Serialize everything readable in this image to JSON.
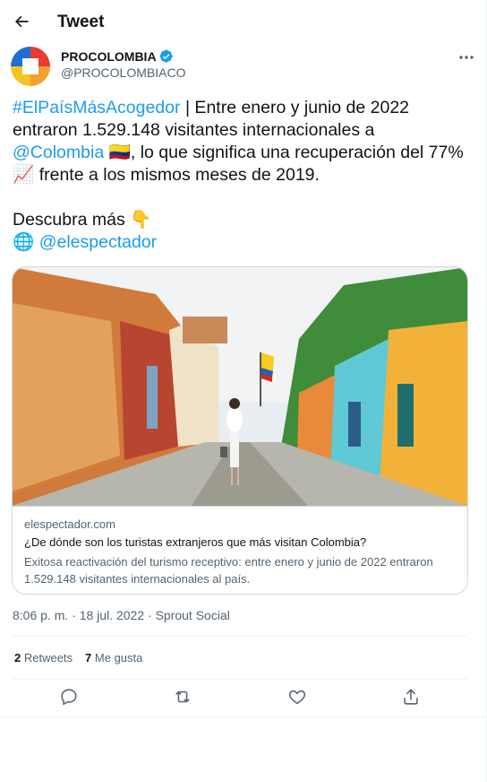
{
  "header": {
    "title": "Tweet"
  },
  "author": {
    "name": "PROCOLOMBIA",
    "handle": "@PROCOLOMBIACO"
  },
  "tweet": {
    "hashtag": "#ElPaísMásAcogedor",
    "t1": " | Entre enero y junio de 2022 entraron 1.529.148 visitantes internacionales a ",
    "mention": "@Colombia",
    "flag": "🇨🇴",
    "t2": ", lo que significa una recuperación del 77% ",
    "chart_emoji": "📈",
    "t3": " frente a los mismos meses de 2019.",
    "line2": "Descubra más ",
    "point_emoji": "👇",
    "globe": "🌐",
    "mention2": "@elespectador"
  },
  "card": {
    "domain": "elespectador.com",
    "title": "¿De dónde son los turistas extranjeros que más visitan Colombia?",
    "description": "Exitosa reactivación del turismo receptivo: entre enero y junio de 2022 entraron 1.529.148 visitantes internacionales al país."
  },
  "meta": {
    "time": "8:06 p. m.",
    "sep": " · ",
    "date": "18 jul. 2022",
    "source": "Sprout Social"
  },
  "stats": {
    "retweets_count": "2",
    "retweets_label": " Retweets",
    "likes_count": "7",
    "likes_label": " Me gusta"
  },
  "colors": {
    "accent": "#1d9bf0",
    "text": "#0f1419",
    "secondary": "#536471"
  }
}
